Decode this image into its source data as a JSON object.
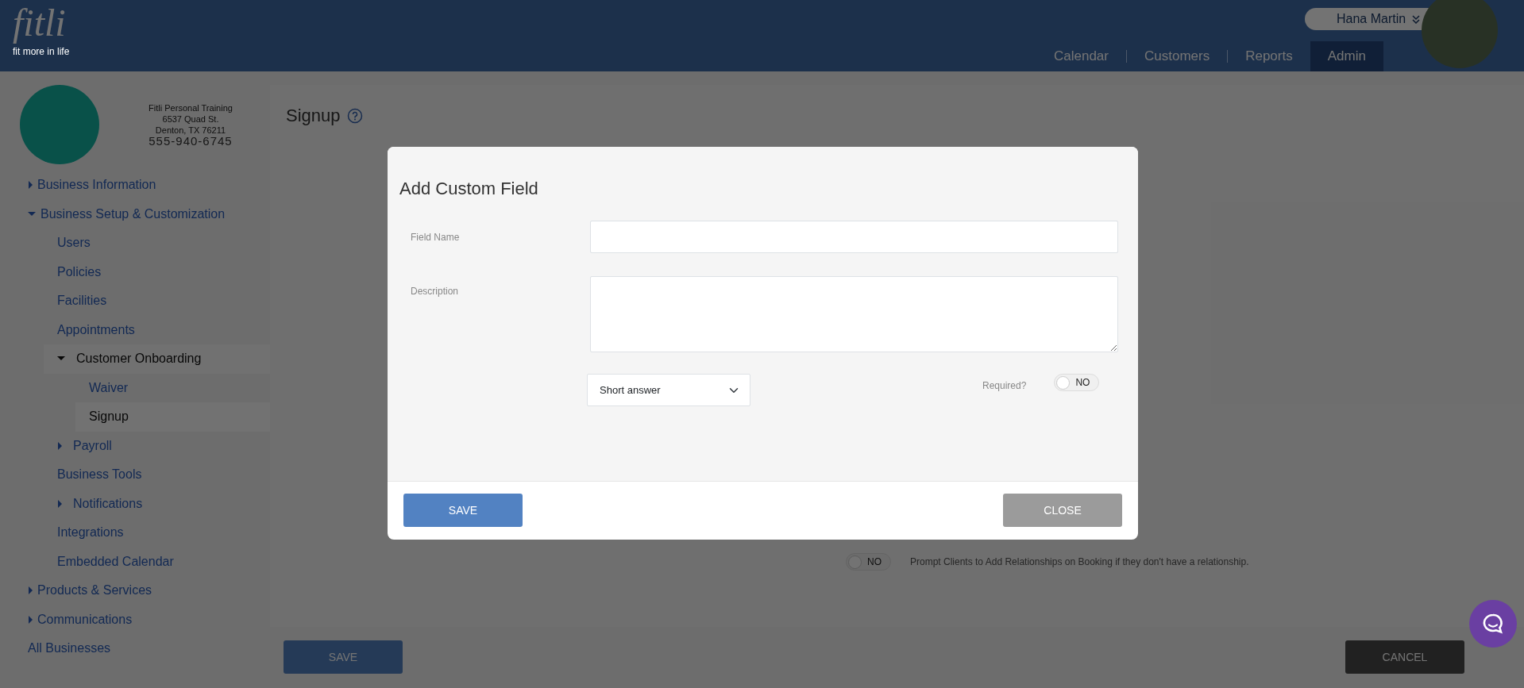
{
  "header": {
    "logo_text": "fitli",
    "logo_tagline": "fit more in life",
    "user": {
      "name": "Hana Martin"
    },
    "nav": [
      {
        "label": "Calendar",
        "selected": false
      },
      {
        "label": "Customers",
        "selected": false
      },
      {
        "label": "Reports",
        "selected": false
      },
      {
        "label": "Admin",
        "selected": true
      }
    ]
  },
  "business": {
    "name": "Fitli Personal Training",
    "address_line1": "6537 Quad St.",
    "address_line2": "Denton, TX 76211",
    "phone": "555-940-6745"
  },
  "sidebar": {
    "items": [
      {
        "label": "Business Information",
        "kind": "group",
        "expanded": false,
        "selected": false
      },
      {
        "label": "Business Setup & Customization",
        "kind": "group",
        "expanded": true,
        "selected": false,
        "children": [
          {
            "label": "Users",
            "kind": "link",
            "selected": false
          },
          {
            "label": "Policies",
            "kind": "link",
            "selected": false
          },
          {
            "label": "Facilities",
            "kind": "link",
            "selected": false
          },
          {
            "label": "Appointments",
            "kind": "link",
            "selected": false
          },
          {
            "label": "Customer Onboarding",
            "kind": "group",
            "expanded": true,
            "selected": true,
            "children": [
              {
                "label": "Waiver",
                "kind": "link",
                "selected": false
              },
              {
                "label": "Signup",
                "kind": "link",
                "selected": true
              }
            ]
          },
          {
            "label": "Payroll",
            "kind": "group",
            "expanded": false,
            "selected": false
          },
          {
            "label": "Business Tools",
            "kind": "link",
            "selected": false
          },
          {
            "label": "Notifications",
            "kind": "group",
            "expanded": false,
            "selected": false
          },
          {
            "label": "Integrations",
            "kind": "link",
            "selected": false
          },
          {
            "label": "Embedded Calendar",
            "kind": "link",
            "selected": false
          }
        ]
      },
      {
        "label": "Products & Services",
        "kind": "group",
        "expanded": false,
        "selected": false
      },
      {
        "label": "Communications",
        "kind": "group",
        "expanded": false,
        "selected": false
      },
      {
        "label": "All Businesses",
        "kind": "link",
        "selected": false
      }
    ]
  },
  "page": {
    "title": "Signup",
    "relationship_prompt": {
      "on": false,
      "state_label": "NO",
      "text": "Prompt Clients to Add Relationships on Booking if they don't have a relationship."
    },
    "buttons": [
      {
        "label": "SAVE",
        "kind": "primary"
      },
      {
        "label": "CANCEL",
        "kind": "secondary"
      }
    ]
  },
  "modal": {
    "title": "Add Custom Field",
    "fields": [
      {
        "label": "Field Name",
        "kind": "input"
      },
      {
        "label": "Description",
        "kind": "textarea"
      }
    ],
    "answer_type": "Short answer",
    "required": {
      "label": "Required?",
      "on": false,
      "state_label": "NO"
    },
    "buttons": [
      {
        "label": "SAVE",
        "kind": "primary"
      },
      {
        "label": "CLOSE",
        "kind": "secondary"
      }
    ]
  }
}
